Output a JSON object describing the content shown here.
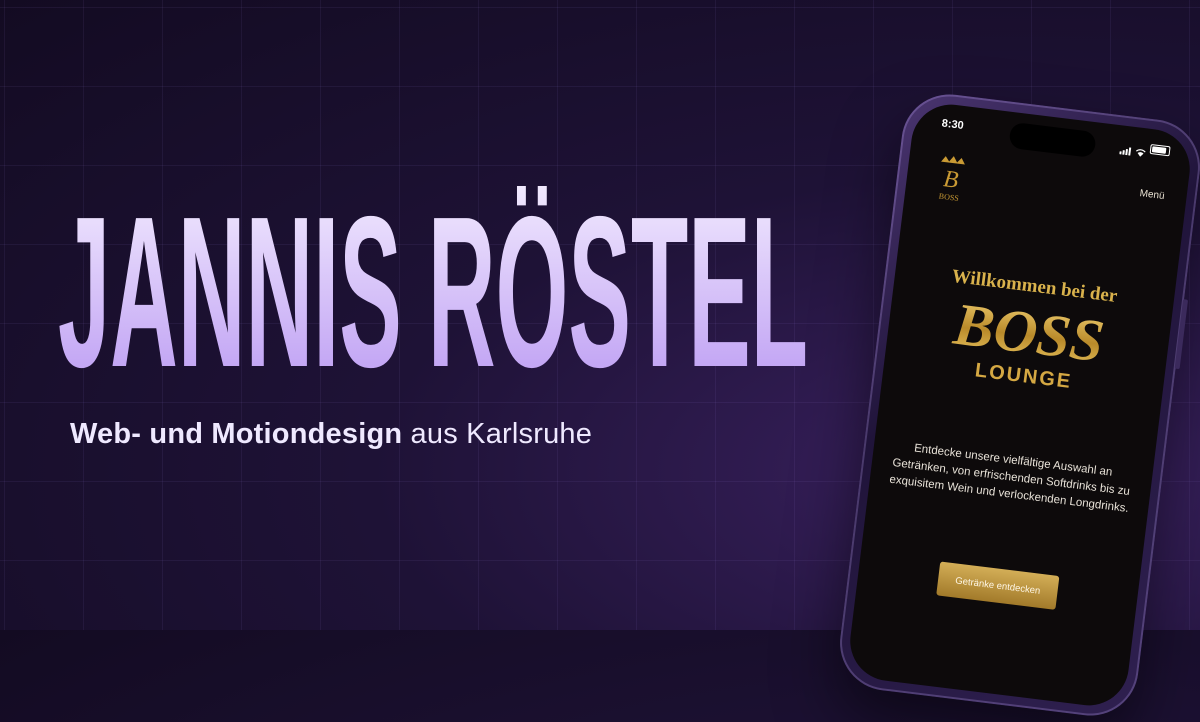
{
  "hero": {
    "name": "JANNIS RÖSTEL",
    "tagline_bold": "Web- und Motiondesign",
    "tagline_rest": "aus Karlsruhe"
  },
  "phone": {
    "status_time": "8:30",
    "menu_label": "Menü",
    "logo_letter": "B",
    "logo_text": "BOSS",
    "welcome": "Willkommen bei der",
    "brand_main": "BOSS",
    "brand_sub": "LOUNGE",
    "description": "Entdecke unsere vielfältige Auswahl an Getränken, von erfrischenden Softdrinks bis zu exquisitem Wein und verlockenden Longdrinks.",
    "cta_label": "Getränke entdecken"
  },
  "colors": {
    "background": "#1e1236",
    "headline_top": "#f5efff",
    "headline_bottom": "#b896f2",
    "gold": "#d4a843"
  }
}
